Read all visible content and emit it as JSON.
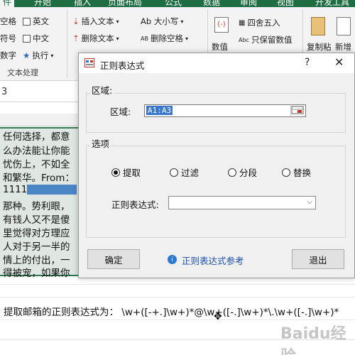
{
  "ribbon": {
    "tabs": [
      "件",
      "开始",
      "插入",
      "页面布局",
      "公式",
      "数据",
      "审阅",
      "视图",
      "开发工具"
    ],
    "active_tab": "件",
    "items": {
      "space": "空格",
      "english": "英文",
      "symbol": "符号",
      "chinese": "中文",
      "number": "数字",
      "execute": "执行",
      "insert_text": "插入文本",
      "delete_text": "删除文本",
      "case": "Ab 大小写",
      "delete_space": "删除空格",
      "round": "四舍五入",
      "keep_value": "只保留数值",
      "numeric": "数值",
      "copy_paste": "复制粘",
      "new_add": "新增"
    },
    "group_text_processing": "文本处理"
  },
  "sheet": {
    "name_box": "3",
    "cell_lines": [
      "任何选择，都意",
      "么办法能让你能",
      "忧伤上，不如全",
      "和繁华。From：",
      "1111",
      "那种。势利眼，",
      "有钱人又不是傻",
      "里觉得对方理应",
      "人对于另一半的",
      "情上的付出，一",
      "得被宠，如果你"
    ],
    "bottom_text": "提取邮箱的正则表达式为： \\w+([-+.]\\w+)*@\\w+([-.]\\w+)*\\.\\w+([-.]\\w+)*"
  },
  "dialog": {
    "title": "正则表达式",
    "help": "?",
    "close": "✕",
    "region_section": "区域:",
    "region_label": "区域:",
    "region_value": "A1:A3",
    "options_section": "选项",
    "radios": [
      {
        "label": "提取",
        "checked": true
      },
      {
        "label": "过滤",
        "checked": false
      },
      {
        "label": "分段",
        "checked": false
      },
      {
        "label": "替换",
        "checked": false
      }
    ],
    "regex_label": "正则表达式:",
    "regex_value": "",
    "ok_button": "确定",
    "reference_link": "正则表达式参考",
    "exit_button": "退出"
  },
  "watermark": "Baidu经验",
  "colors": {
    "ribbon_green": "#1f6e43",
    "selection_blue": "#3b78c9",
    "link_blue": "#1a4fa8"
  }
}
